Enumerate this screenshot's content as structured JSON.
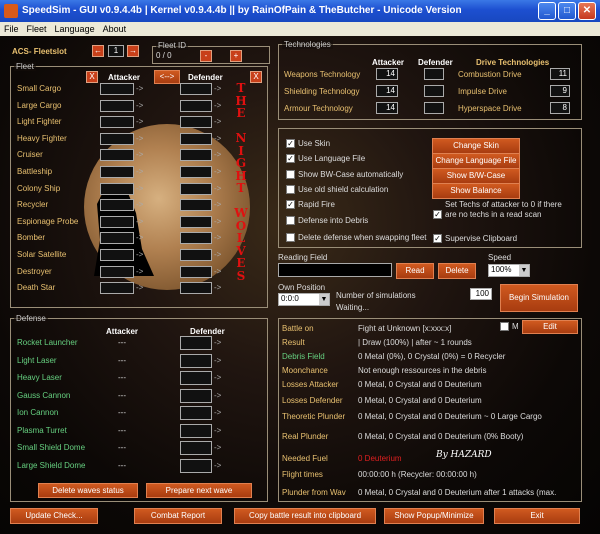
{
  "window": {
    "title": "SpeedSim - GUI v0.9.4.4b | Kernel v0.9.4.4b || by RainOfPain & TheButcher - Unicode Version",
    "min": "_",
    "max": "□",
    "close": "✕"
  },
  "menu": [
    "File",
    "Fleet",
    "Language",
    "About"
  ],
  "fleetslot": {
    "label": "ACS- Fleetslot",
    "value": "1",
    "prev": "←",
    "next": "→",
    "fleet_id": "0 / 0",
    "fleet_label": "Fleet ID",
    "minus": "-",
    "plus": "+"
  },
  "fleet": {
    "caption": "Fleet",
    "attacker": "Attacker",
    "defender": "Defender",
    "swap": "<-->",
    "x": "X",
    "ships": [
      "Small Cargo",
      "Large Cargo",
      "Light Fighter",
      "Heavy Fighter",
      "Cruiser",
      "Battleship",
      "Colony Ship",
      "Recycler",
      "Espionage Probe",
      "Bomber",
      "Solar Satellite",
      "Destroyer",
      "Death Star"
    ]
  },
  "vertical": [
    "T",
    "H",
    "E",
    "",
    "N",
    "I",
    "G",
    "H",
    "T",
    "",
    "W",
    "O",
    "L",
    "V",
    "E",
    "S"
  ],
  "defense": {
    "caption": "Defense",
    "attacker": "Attacker",
    "defender": "Defender",
    "dash": "---",
    "items": [
      "Rocket Launcher",
      "Light Laser",
      "Heavy Laser",
      "Gauss Cannon",
      "Ion Cannon",
      "Plasma Turret",
      "Small Shield Dome",
      "Large Shield Dome"
    ],
    "delete_waves": "Delete waves status",
    "prepare_wave": "Prepare next wave"
  },
  "tech": {
    "caption": "Technologies",
    "attacker": "Attacker",
    "defender": "Defender",
    "drive": "Drive Technologies",
    "weapons": "Weapons Technology",
    "shielding": "Shielding Technology",
    "armour": "Armour Technology",
    "weapons_val": "14",
    "shielding_val": "14",
    "armour_val": "14",
    "combustion": "Combustion Drive",
    "impulse": "Impulse Drive",
    "hyperspace": "Hyperspace Drive",
    "combustion_val": "11",
    "impulse_val": "9",
    "hyperspace_val": "8"
  },
  "options": {
    "use_skin": "Use Skin",
    "use_lang": "Use Language File",
    "show_bw": "Show BW-Case automatically",
    "old_shield": "Use old shield calculation",
    "rapid_fire": "Rapid Fire",
    "def_debris": "Defense into Debris",
    "delete_swap": "Delete defense when swapping fleet",
    "set_techs": "Set Techs of attacker to 0 if there are no techs in a read scan",
    "supervise": "Supervise Clipboard",
    "change_skin": "Change Skin",
    "change_lang": "Change Language File",
    "show_bw_btn": "Show B/W-Case",
    "show_balance": "Show Balance"
  },
  "reading": {
    "label": "Reading Field",
    "read": "Read",
    "delete": "Delete",
    "speed_label": "Speed",
    "speed": "100%"
  },
  "own": {
    "label": "Own Position",
    "value": "0:0:0",
    "sims_label": "Number of simulations",
    "sims": "100",
    "waiting": "Waiting...",
    "begin": "Begin Simulation"
  },
  "results": {
    "battle_on_label": "Battle on",
    "battle_on": "Fight at Unknown [x:xxx:x]",
    "m": "M",
    "edit": "Edit",
    "result_label": "Result",
    "result": "| Draw (100%) | after ~ 1 rounds",
    "debris_label": "Debris Field",
    "debris": "0 Metal (0%), 0 Crystal (0%) = 0 Recycler",
    "moon_label": "Moonchance",
    "moon": "Not enough ressources in the debris",
    "losses_att_label": "Losses Attacker",
    "losses_att": "0 Metal, 0 Crystal and 0 Deuterium",
    "losses_def_label": "Losses Defender",
    "losses_def": "0 Metal, 0 Crystal and 0 Deuterium",
    "plunder_label": "Theoretic Plunder",
    "plunder": "0 Metal, 0 Crystal and 0 Deuterium ~ 0 Large Cargo",
    "real_label": "Real Plunder",
    "real": "0 Metal, 0 Crystal and 0 Deuterium (0% Booty)",
    "fuel_label": "Needed Fuel",
    "fuel": "0 Deuterium",
    "flight_label": "Flight times",
    "flight": "00:00:00 h (Recycler: 00:00:00 h)",
    "waves_label": "Plunder from Wav",
    "waves": "0 Metal, 0 Crystal and 0 Deuterium after 1 attacks (max.",
    "signature": "By HAZARD"
  },
  "bottom": {
    "update": "Update Check...",
    "report": "Combat Report",
    "copy": "Copy battle result into clipboard",
    "popup": "Show Popup/Minimize",
    "exit": "Exit"
  },
  "colors": {
    "accent": "#c8501a",
    "label_orange": "#e8c070",
    "label_green": "#66d080",
    "cyan": "#26d0f0",
    "title_blue": "#1d4fd0"
  }
}
